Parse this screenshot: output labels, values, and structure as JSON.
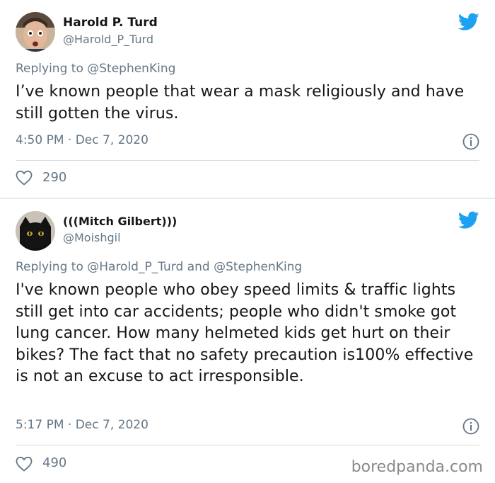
{
  "tweets": [
    {
      "author": "Harold P. Turd",
      "handle": "@Harold_P_Turd",
      "reply_to": "Replying to @StephenKing",
      "text": "I’ve known people that wear a mask religiously and have still gotten the virus.",
      "timestamp": "4:50 PM · Dec 7, 2020",
      "likes": "290",
      "avatar_icon": "man-portrait-avatar",
      "brand_color": "#1da1f2"
    },
    {
      "author": "(((Mitch Gilbert)))",
      "handle": "@Moishgil",
      "reply_to": "Replying to @Harold_P_Turd and @StephenKing",
      "text": "I've known people who obey speed limits & traffic lights still get into car accidents; people who didn't smoke got lung cancer. How many helmeted kids get hurt on their bikes?  The fact that no safety precaution is100% effective is not an excuse to act irresponsible.",
      "timestamp": "5:17 PM · Dec 7, 2020",
      "likes": "490",
      "avatar_icon": "black-cat-avatar",
      "brand_color": "#1da1f2"
    }
  ],
  "watermark": "boredpanda.com"
}
